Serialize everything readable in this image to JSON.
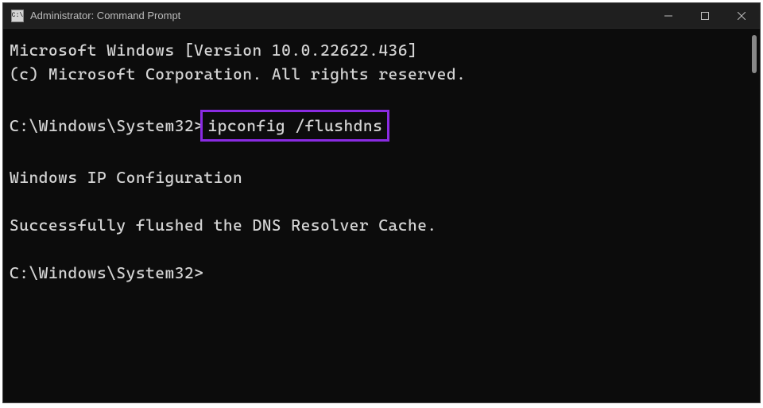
{
  "titlebar": {
    "icon_text": "C:\\",
    "title": "Administrator: Command Prompt"
  },
  "terminal": {
    "line1": "Microsoft Windows [Version 10.0.22622.436]",
    "line2": "(c) Microsoft Corporation. All rights reserved.",
    "prompt1": "C:\\Windows\\System32>",
    "command1": "ipconfig /flushdns",
    "line3": "Windows IP Configuration",
    "line4": "Successfully flushed the DNS Resolver Cache.",
    "prompt2": "C:\\Windows\\System32>"
  },
  "colors": {
    "highlight": "#8a2be2"
  }
}
